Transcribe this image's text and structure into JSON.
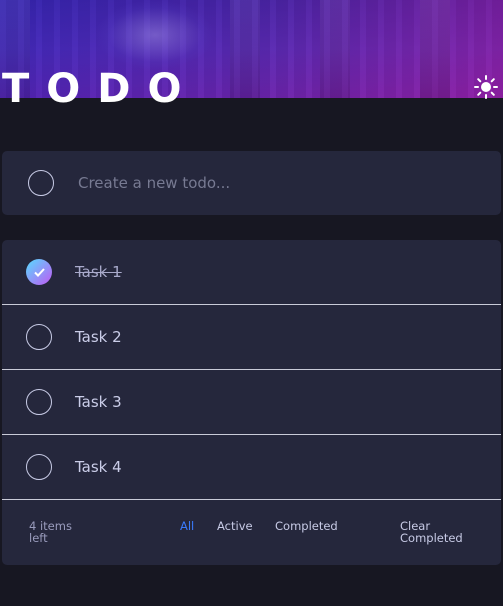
{
  "header": {
    "title": "TODO",
    "theme_icon": "sun-icon"
  },
  "new_todo": {
    "placeholder": "Create a new todo..."
  },
  "todos": [
    {
      "label": "Task 1",
      "completed": true
    },
    {
      "label": "Task 2",
      "completed": false
    },
    {
      "label": "Task 3",
      "completed": false
    },
    {
      "label": "Task 4",
      "completed": false
    }
  ],
  "footer": {
    "items_left": "4 items left",
    "filters": {
      "all": "All",
      "active": "Active",
      "completed": "Completed"
    },
    "active_filter": "All",
    "clear_completed": "Clear Completed"
  },
  "colors": {
    "background": "#171722",
    "card": "#25273c",
    "accent": "#3a7bfd",
    "check_gradient_start": "#57ddff",
    "check_gradient_end": "#c058f3"
  }
}
